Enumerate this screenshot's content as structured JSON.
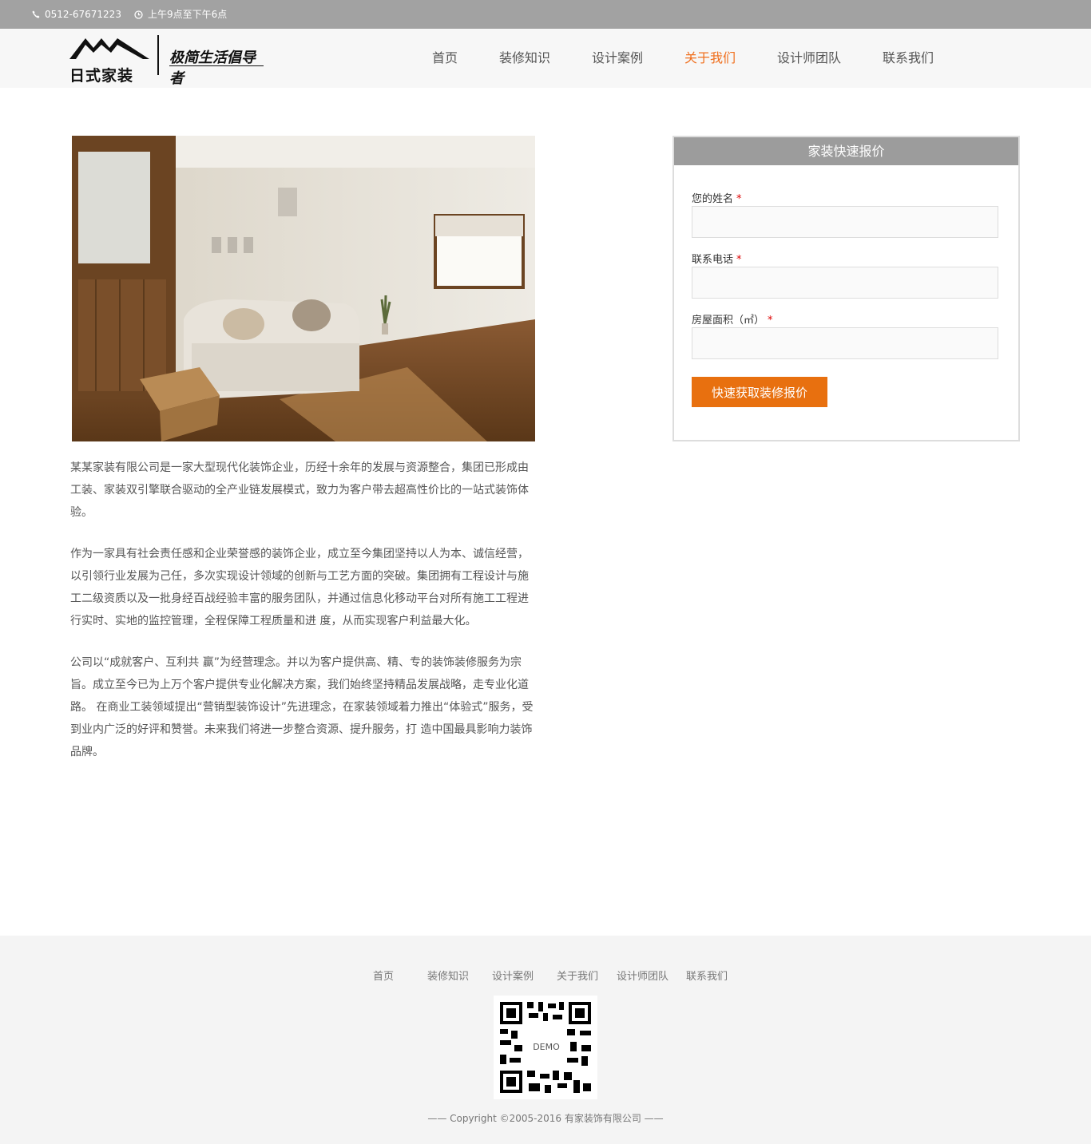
{
  "topbar": {
    "phone": "0512-67671223",
    "hours": "上午9点至下午6点"
  },
  "logo": {
    "name": "日式家装",
    "slogan": "极简生活倡导者"
  },
  "nav": {
    "items": [
      {
        "label": "首页",
        "active": false
      },
      {
        "label": "装修知识",
        "active": false
      },
      {
        "label": "设计案例",
        "active": false
      },
      {
        "label": "关于我们",
        "active": true
      },
      {
        "label": "设计师团队",
        "active": false
      },
      {
        "label": "联系我们",
        "active": false
      }
    ]
  },
  "article": {
    "paragraphs": [
      "某某家装有限公司是一家大型现代化装饰企业，历经十余年的发展与资源整合，集团已形成由工装、家装双引擎联合驱动的全产业链发展模式，致力为客户带去超高性价比的一站式装饰体验。",
      "作为一家具有社会责任感和企业荣誉感的装饰企业，成立至今集团坚持以人为本、诚信经营，以引领行业发展为己任，多次实现设计领域的创新与工艺方面的突破。集团拥有工程设计与施工二级资质以及一批身经百战经验丰富的服务团队，并通过信息化移动平台对所有施工工程进行实时、实地的监控管理，全程保障工程质量和进 度，从而实现客户利益最大化。",
      "公司以“成就客户、互利共 赢”为经营理念。并以为客户提供高、精、专的装饰装修服务为宗旨。成立至今已为上万个客户提供专业化解决方案，我们始终坚持精品发展战略，走专业化道路。 在商业工装领域提出“营销型装饰设计”先进理念，在家装领域着力推出“体验式”服务，受到业内广泛的好评和赞誉。未来我们将进一步整合资源、提升服务，打 造中国最具影响力装饰品牌。"
    ]
  },
  "quote": {
    "title": "家装快速报价",
    "name_label": "您的姓名",
    "phone_label": "联系电话",
    "area_label": "房屋面积（㎡）",
    "required_mark": "*",
    "submit": "快速获取装修报价"
  },
  "footer": {
    "nav": [
      "首页",
      "装修知识",
      "设计案例",
      "关于我们",
      "设计师团队",
      "联系我们"
    ],
    "qr_label": "DEMO",
    "copyright": "—— Copyright ©2005-2016 有家装饰有限公司 ——"
  },
  "colors": {
    "accent": "#f06f1d",
    "button": "#e8700f",
    "topbar": "#a2a2a2",
    "form_title": "#9c9c9c"
  }
}
